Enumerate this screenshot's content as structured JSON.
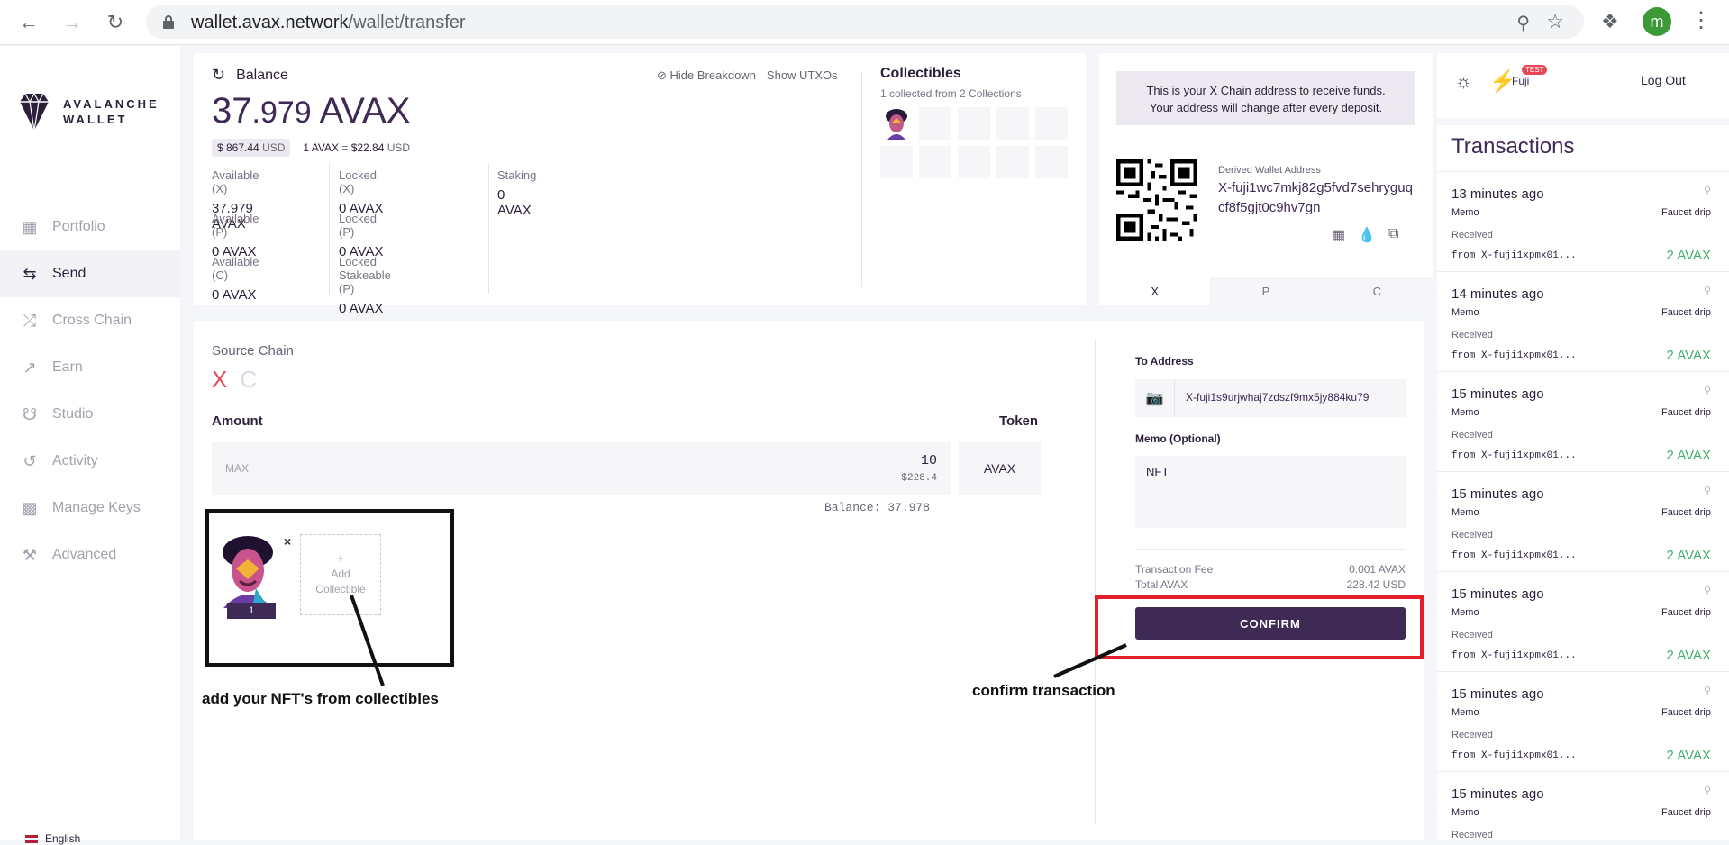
{
  "browser": {
    "url_domain": "wallet.avax.network",
    "url_path": "/wallet/transfer",
    "profile_initial": "m"
  },
  "sidebar": {
    "logo_line1": "AVALANCHE",
    "logo_line2": "WALLET",
    "items": [
      {
        "label": "Portfolio",
        "icon": "portfolio-icon"
      },
      {
        "label": "Send",
        "icon": "send-icon"
      },
      {
        "label": "Cross Chain",
        "icon": "cross-chain-icon"
      },
      {
        "label": "Earn",
        "icon": "earn-icon"
      },
      {
        "label": "Studio",
        "icon": "studio-icon"
      },
      {
        "label": "Activity",
        "icon": "activity-icon"
      },
      {
        "label": "Manage Keys",
        "icon": "manage-keys-icon"
      },
      {
        "label": "Advanced",
        "icon": "advanced-icon"
      }
    ],
    "language": "English"
  },
  "balance": {
    "title": "Balance",
    "hide_breakdown": "Hide Breakdown",
    "show_utxos": "Show UTXOs",
    "amount_int": "37",
    "amount_frac": ".979",
    "unit": "AVAX",
    "usd_value": "$ 867.44",
    "usd_unit": "USD",
    "rate_left": "1 AVAX",
    "rate_eq": "=",
    "rate_value": "$22.84",
    "rate_unit": "USD",
    "col1": [
      {
        "label": "Available (X)",
        "value": "37.979 AVAX"
      },
      {
        "label": "Available (P)",
        "value": "0 AVAX"
      },
      {
        "label": "Available (C)",
        "value": "0 AVAX"
      }
    ],
    "col2": [
      {
        "label": "Locked (X)",
        "value": "0 AVAX"
      },
      {
        "label": "Locked (P)",
        "value": "0 AVAX"
      },
      {
        "label": "Locked Stakeable (P)",
        "value": "0 AVAX"
      }
    ],
    "col3": [
      {
        "label": "Staking",
        "value": "0 AVAX"
      }
    ]
  },
  "collectibles": {
    "title": "Collectibles",
    "subtitle": "1 collected from 2 Collections"
  },
  "address": {
    "note_line1": "This is your X Chain address to receive funds.",
    "note_line2": "Your address will change after every deposit.",
    "derived_label": "Derived Wallet Address",
    "derived_value": "X-fuji1wc7mkj82g5fvd7sehryguqcf8f5gjt0c9hv7gn",
    "tabs": [
      "X",
      "P",
      "C"
    ],
    "active_tab": "X"
  },
  "transfer": {
    "source_label": "Source Chain",
    "chain_x": "X",
    "chain_c": "C",
    "amount_label": "Amount",
    "token_label": "Token",
    "max_label": "MAX",
    "amount_value": "10",
    "amount_usd": "$228.4",
    "token_value": "AVAX",
    "balance_line": "Balance: 37.978",
    "nft_count": "1",
    "add_collectible_line1": "Add",
    "add_collectible_line2": "Collectible",
    "to_label": "To Address",
    "to_value": "X-fuji1s9urjwhaj7zdszf9mx5jy884ku79",
    "memo_label": "Memo (Optional)",
    "memo_value": "NFT",
    "fee_label": "Transaction Fee",
    "fee_value": "0.001 AVAX",
    "total_label": "Total AVAX",
    "total_value": "228.42 USD",
    "confirm_label": "CONFIRM",
    "annotation_left": "add your NFT's from collectibles",
    "annotation_right": "confirm transaction"
  },
  "topright": {
    "network": "Fuji",
    "badge": "TEST",
    "logout": "Log Out"
  },
  "transactions": {
    "title": "Transactions",
    "items": [
      {
        "time": "13 minutes ago",
        "memo": "Memo",
        "memo_value": "Faucet drip",
        "type": "Received",
        "from": "from X-fuji1xpmx01...",
        "amount": "2 AVAX"
      },
      {
        "time": "14 minutes ago",
        "memo": "Memo",
        "memo_value": "Faucet drip",
        "type": "Received",
        "from": "from X-fuji1xpmx01...",
        "amount": "2 AVAX"
      },
      {
        "time": "15 minutes ago",
        "memo": "Memo",
        "memo_value": "Faucet drip",
        "type": "Received",
        "from": "from X-fuji1xpmx01...",
        "amount": "2 AVAX"
      },
      {
        "time": "15 minutes ago",
        "memo": "Memo",
        "memo_value": "Faucet drip",
        "type": "Received",
        "from": "from X-fuji1xpmx01...",
        "amount": "2 AVAX"
      },
      {
        "time": "15 minutes ago",
        "memo": "Memo",
        "memo_value": "Faucet drip",
        "type": "Received",
        "from": "from X-fuji1xpmx01...",
        "amount": "2 AVAX"
      },
      {
        "time": "15 minutes ago",
        "memo": "Memo",
        "memo_value": "Faucet drip",
        "type": "Received",
        "from": "from X-fuji1xpmx01...",
        "amount": "2 AVAX"
      },
      {
        "time": "15 minutes ago",
        "memo": "Memo",
        "memo_value": "Faucet drip",
        "type": "Received",
        "from": "",
        "amount": ""
      }
    ]
  },
  "colors": {
    "brand": "#3f2a56",
    "danger": "#e84855",
    "success": "#3fb06b",
    "annotation_red": "#e3202a"
  }
}
